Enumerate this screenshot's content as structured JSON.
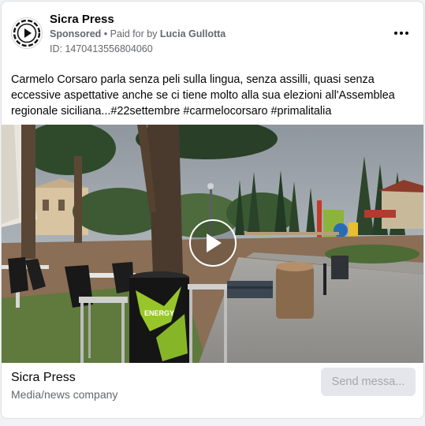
{
  "post": {
    "page_name": "Sicra Press",
    "sponsored_label": "Sponsored",
    "separator": "•",
    "paid_for_prefix": "Paid for by",
    "paid_for_name": "Lucia Gullotta",
    "ad_id": "ID: 1470413556804060",
    "more_icon": "more-horizontal-icon",
    "caption": "Carmelo Corsaro parla senza peli sulla lingua, senza assilli, quasi senza eccessive aspettative anche se ci tiene molto alla sua elezioni all'Assemblea regionale siciliana...#22settembre #carmelocorsaro #primalitalia",
    "media_icon": "play-icon"
  },
  "footer": {
    "page_name": "Sicra Press",
    "category": "Media/news company",
    "cta_label": "Send messa..."
  }
}
